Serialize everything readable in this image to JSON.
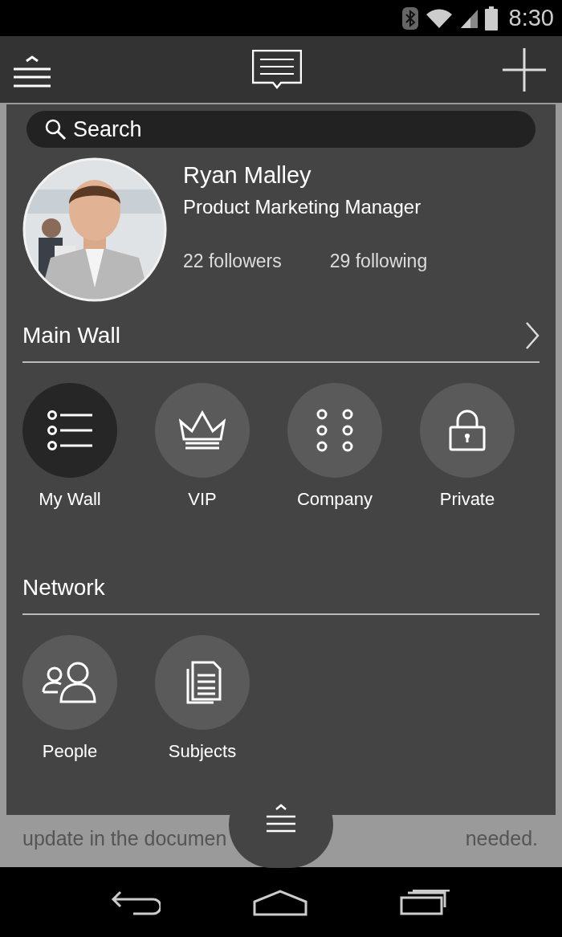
{
  "status_bar": {
    "time": "8:30"
  },
  "search": {
    "placeholder": "Search"
  },
  "profile": {
    "name": "Ryan Malley",
    "title": "Product Marketing Manager",
    "followers": "22 followers",
    "following": "29 following"
  },
  "sections": [
    {
      "title": "Main Wall",
      "chevron": true,
      "items": [
        {
          "label": "My Wall",
          "kind": "list",
          "selected": true
        },
        {
          "label": "VIP",
          "kind": "crown",
          "selected": false
        },
        {
          "label": "Company",
          "kind": "dots",
          "selected": false
        },
        {
          "label": "Private",
          "kind": "lock",
          "selected": false
        }
      ]
    },
    {
      "title": "Network",
      "chevron": false,
      "items": [
        {
          "label": "People",
          "kind": "people",
          "selected": false
        },
        {
          "label": "Subjects",
          "kind": "documents",
          "selected": false
        }
      ]
    }
  ],
  "feed_line": {
    "left": "update in the documen",
    "right": "needed."
  }
}
